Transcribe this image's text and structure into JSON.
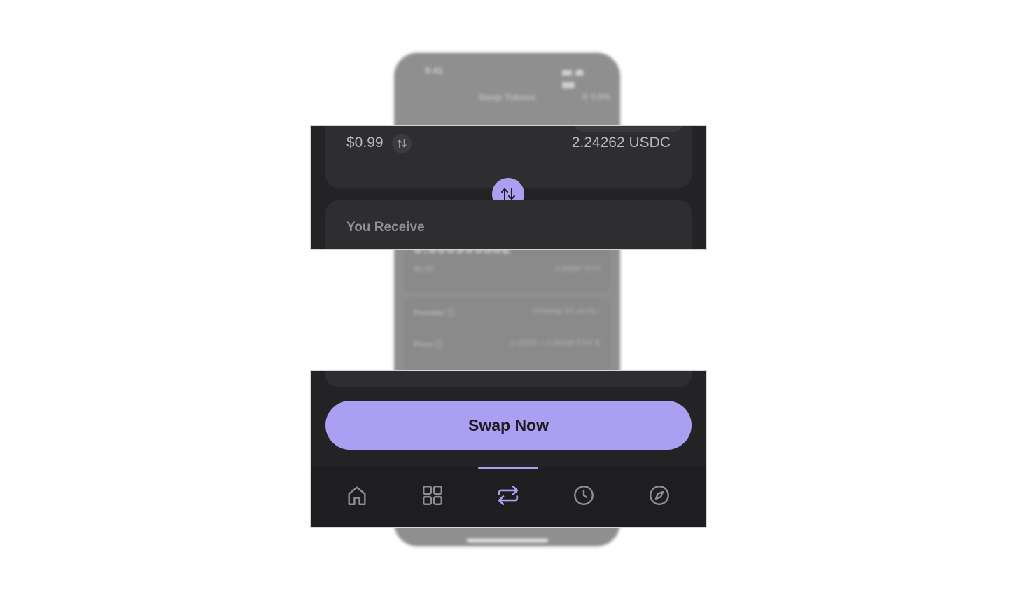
{
  "background": {
    "status_time": "9:41",
    "screen_title": "Swap Tokens",
    "slippage": "0.5%",
    "receive_amount": "0.000999882",
    "receive_usd": "$0.99",
    "receive_balance": "0.00087 ETH",
    "provider_label": "Provider ⓘ",
    "provider_value": "Uniswap V4 via 0x ›",
    "price_label": "Price ⓘ",
    "price_value": "1 USDC ≈ 0.00036 ETH ⇅"
  },
  "pay": {
    "usd_value": "$0.99",
    "balance": "2.24262 USDC"
  },
  "receive": {
    "label": "You Receive"
  },
  "action": {
    "swap_label": "Swap Now"
  },
  "tabs": [
    {
      "icon": "home-icon",
      "active": false
    },
    {
      "icon": "grid-icon",
      "active": false
    },
    {
      "icon": "swap-icon",
      "active": true
    },
    {
      "icon": "clock-icon",
      "active": false
    },
    {
      "icon": "compass-icon",
      "active": false
    }
  ],
  "colors": {
    "accent": "#ab9ff2",
    "panel_bg": "#232325",
    "card_bg": "#2e2e31",
    "tabbar_bg": "#1e1e20",
    "icon_inactive": "#8e8e93"
  }
}
